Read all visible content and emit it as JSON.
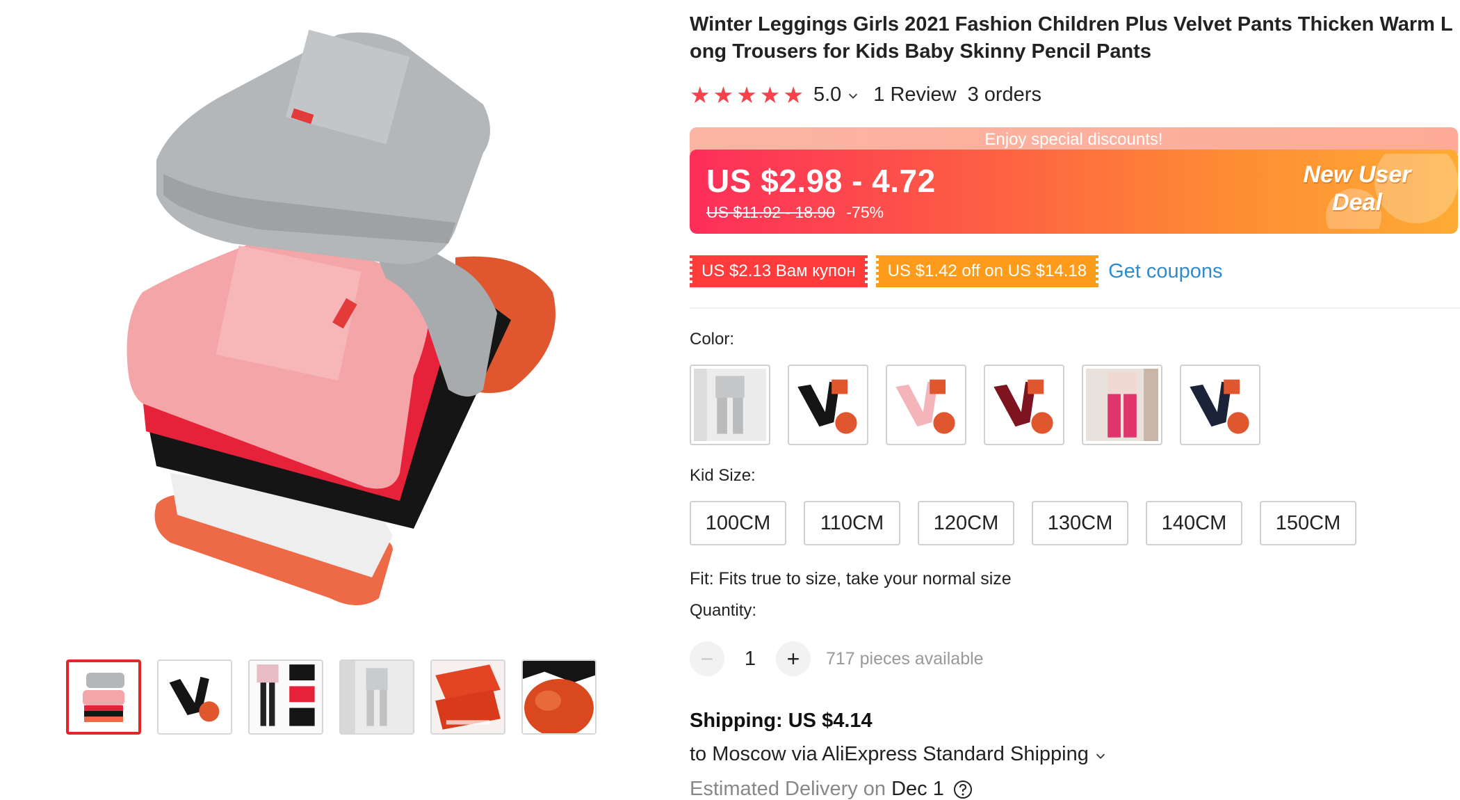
{
  "product": {
    "title": "Winter Leggings Girls 2021 Fashion Children Plus Velvet Pants Thicken Warm Long Trousers for Kids Baby Skinny Pencil Pants"
  },
  "rating": {
    "stars": 5,
    "value": "5.0",
    "reviews": "1 Review",
    "orders": "3 orders"
  },
  "price": {
    "banner_top": "Enjoy special discounts!",
    "current": "US $2.98 - 4.72",
    "original": "US $11.92 - 18.90",
    "discount": "-75%",
    "new_user_line1": "New User",
    "new_user_line2": "Deal"
  },
  "coupons": {
    "coupon1": "US $2.13 Вам купон",
    "coupon2": "US $1.42 off on US $14.18",
    "get_coupons": "Get coupons"
  },
  "color": {
    "label": "Color:",
    "options": [
      "grey",
      "black",
      "pink",
      "wine red",
      "rose",
      "navy"
    ]
  },
  "size": {
    "label": "Kid Size:",
    "options": [
      "100CM",
      "110CM",
      "120CM",
      "130CM",
      "140CM",
      "150CM"
    ]
  },
  "fit": "Fit: Fits true to size, take your normal size",
  "quantity": {
    "label": "Quantity:",
    "minus": "−",
    "plus": "+",
    "value": "1",
    "available": "717 pieces available"
  },
  "shipping": {
    "title": "Shipping: US $4.14",
    "route": "to Moscow via AliExpress Standard Shipping",
    "estimated_label": "Estimated Delivery on",
    "date": "Dec 1"
  },
  "colors": {
    "accent_red": "#e0282b",
    "link_blue": "#2e8bd0",
    "star": "#f5424b",
    "coupon_red": "#ff3b3b",
    "coupon_orange": "#ff9b1a"
  }
}
